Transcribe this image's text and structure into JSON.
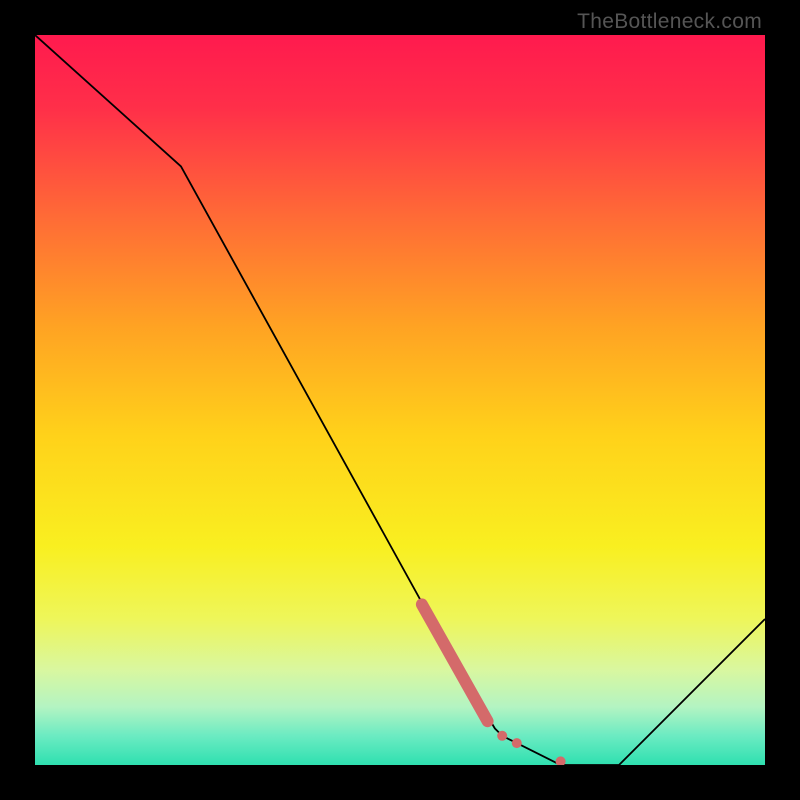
{
  "watermark": "TheBottleneck.com",
  "chart_data": {
    "type": "line",
    "title": "",
    "xlabel": "",
    "ylabel": "",
    "ylim": [
      0,
      100
    ],
    "xlim": [
      0,
      100
    ],
    "curve": {
      "x": [
        0,
        20,
        57,
        63,
        64,
        66,
        72,
        75,
        80,
        85,
        100
      ],
      "y": [
        100,
        82,
        15,
        5,
        4,
        3,
        0,
        0,
        0,
        5,
        20
      ]
    },
    "segment": {
      "x0": 53,
      "y0": 22,
      "x1": 62,
      "y1": 6,
      "width": 12,
      "color": "#d46a6a"
    },
    "dots": [
      {
        "x": 64,
        "y": 4,
        "r": 5
      },
      {
        "x": 66,
        "y": 3,
        "r": 5
      },
      {
        "x": 72,
        "y": 0.5,
        "r": 5
      }
    ],
    "gradient_stops": [
      {
        "offset": 0.0,
        "color": "#ff1a4e"
      },
      {
        "offset": 0.1,
        "color": "#ff2f49"
      },
      {
        "offset": 0.25,
        "color": "#ff6b36"
      },
      {
        "offset": 0.4,
        "color": "#ffa323"
      },
      {
        "offset": 0.55,
        "color": "#ffd21a"
      },
      {
        "offset": 0.7,
        "color": "#f9ef20"
      },
      {
        "offset": 0.8,
        "color": "#eef65a"
      },
      {
        "offset": 0.87,
        "color": "#d9f7a0"
      },
      {
        "offset": 0.92,
        "color": "#b4f4c2"
      },
      {
        "offset": 0.96,
        "color": "#6bebc2"
      },
      {
        "offset": 1.0,
        "color": "#2fe0b0"
      }
    ],
    "line_color": "#000000",
    "line_width": 1.8
  }
}
